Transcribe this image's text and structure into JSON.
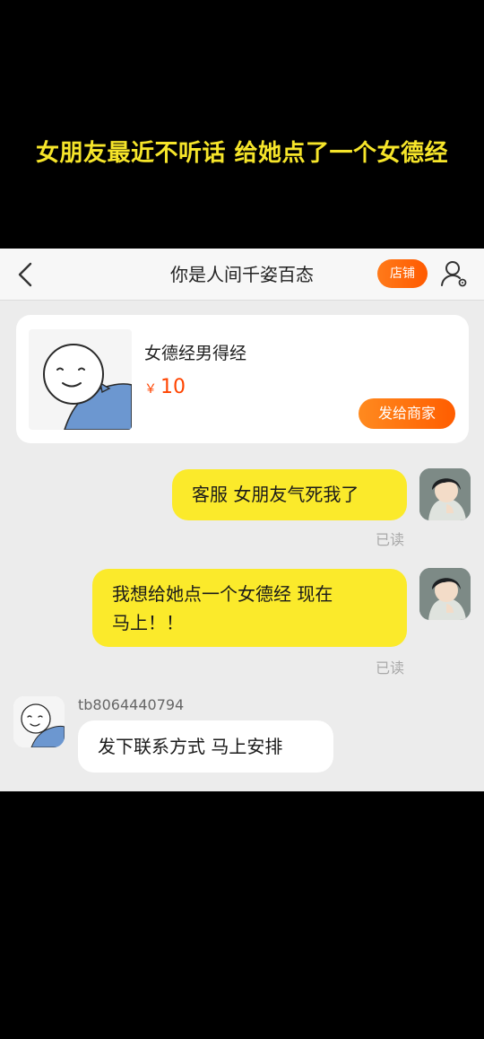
{
  "caption": "女朋友最近不听话 给她点了一个女德经",
  "nav": {
    "back_icon": "chevron-left-icon",
    "title": "你是人间千姿百态",
    "store_label": "店铺",
    "user_icon": "user-settings-icon"
  },
  "product": {
    "name": "女德经男得经",
    "currency": "￥",
    "price": "10",
    "send_label": "发给商家"
  },
  "messages": {
    "me1": {
      "text": "客服 女朋友气死我了",
      "status": "已读"
    },
    "me2": {
      "line1": "我想给她点一个女德经 现在",
      "line2": "马上！！",
      "status": "已读"
    },
    "other1": {
      "sender": "tb8064440794",
      "text": "发下联系方式 马上安排"
    }
  },
  "colors": {
    "caption": "#f6e52a",
    "accent": "#ff5a00",
    "bubble_me": "#fbea2b",
    "bubble_other": "#ffffff",
    "chat_bg": "#ececec"
  }
}
